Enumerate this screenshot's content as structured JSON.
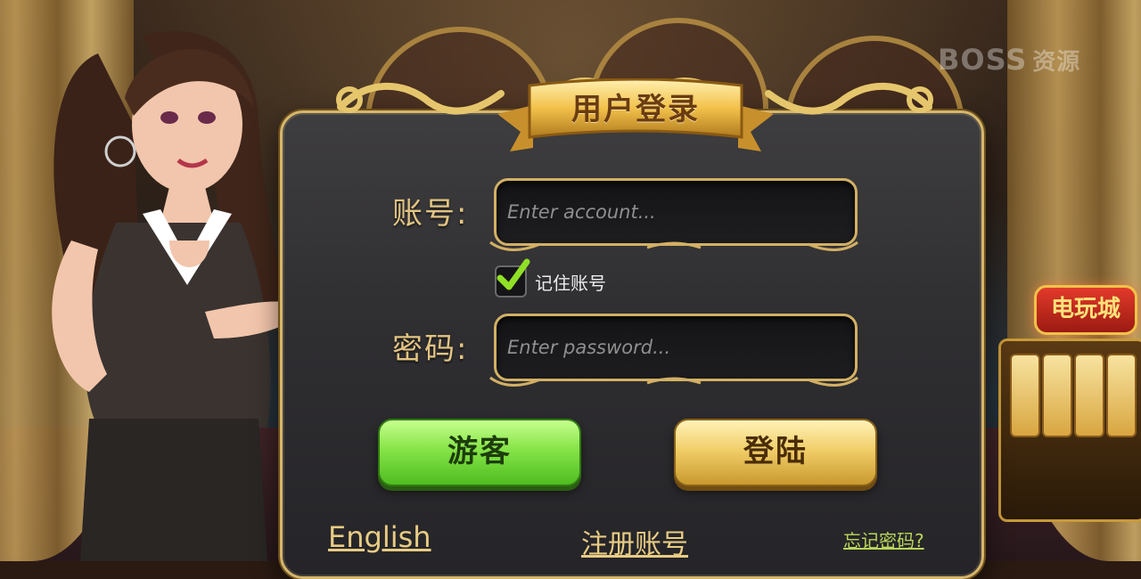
{
  "watermark": {
    "brand": "BOSS",
    "suffix": "资源"
  },
  "casino_sign": "电玩城",
  "dialog": {
    "title": "用户登录"
  },
  "account": {
    "label": "账号:",
    "placeholder": "Enter account...",
    "value": ""
  },
  "remember": {
    "label": "记住账号",
    "checked": true
  },
  "password": {
    "label": "密码:",
    "placeholder": "Enter password...",
    "value": ""
  },
  "buttons": {
    "guest": "游客",
    "login": "登陆"
  },
  "links": {
    "english": "English",
    "register": "注册账号",
    "forgot": "忘记密码?"
  },
  "colors": {
    "gold": "#d7b66a",
    "guest_green": "#86e447",
    "login_gold": "#f1cf6a",
    "panel": "#2f2e31",
    "check_green": "#8fe026"
  }
}
